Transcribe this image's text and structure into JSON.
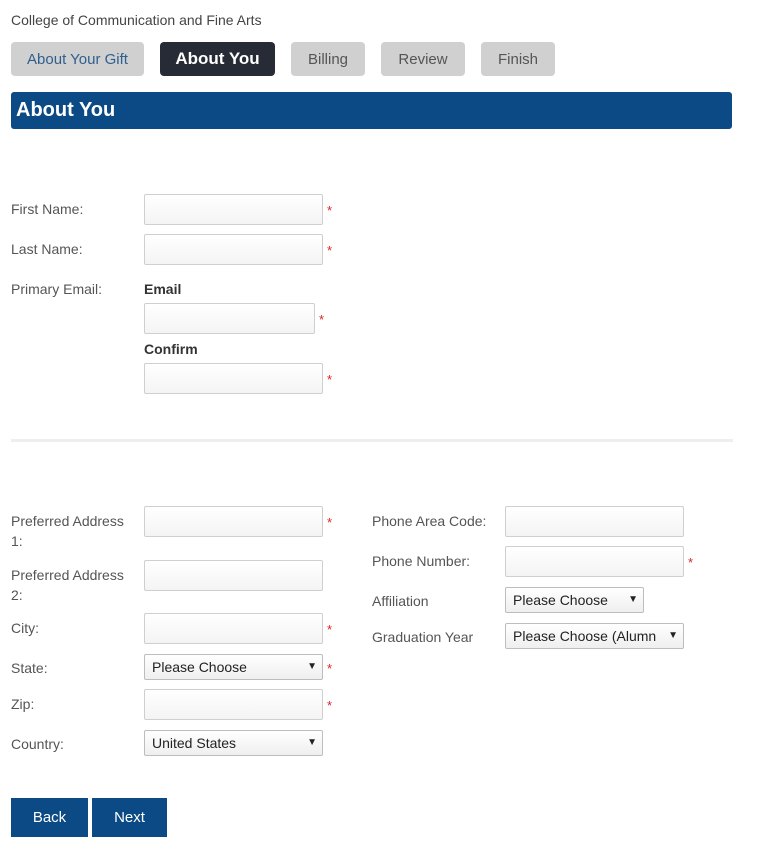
{
  "header": {
    "org": "College of Communication and Fine Arts"
  },
  "tabs": [
    {
      "label": "About Your Gift"
    },
    {
      "label": "About You"
    },
    {
      "label": "Billing"
    },
    {
      "label": "Review"
    },
    {
      "label": "Finish"
    }
  ],
  "section_title": "About You",
  "required_mark": "*",
  "name": {
    "first_label": "First Name:",
    "last_label": "Last Name:"
  },
  "email": {
    "primary_label": "Primary Email:",
    "email_sublabel": "Email",
    "confirm_sublabel": "Confirm"
  },
  "address": {
    "addr1_label": "Preferred Address 1:",
    "addr2_label": "Preferred Address 2:",
    "city_label": "City:",
    "state_label": "State:",
    "state_value": "Please Choose",
    "zip_label": "Zip:",
    "country_label": "Country:",
    "country_value": "United States"
  },
  "phone": {
    "area_label": "Phone Area Code:",
    "number_label": "Phone Number:",
    "affiliation_label": "Affiliation",
    "affiliation_value": "Please Choose",
    "grad_label": "Graduation Year",
    "grad_value": "Please Choose (Alumn"
  },
  "buttons": {
    "back": "Back",
    "next": "Next"
  },
  "colors": {
    "brand": "#0b4a84",
    "active_tab": "#262b35",
    "required": "#e02020"
  }
}
